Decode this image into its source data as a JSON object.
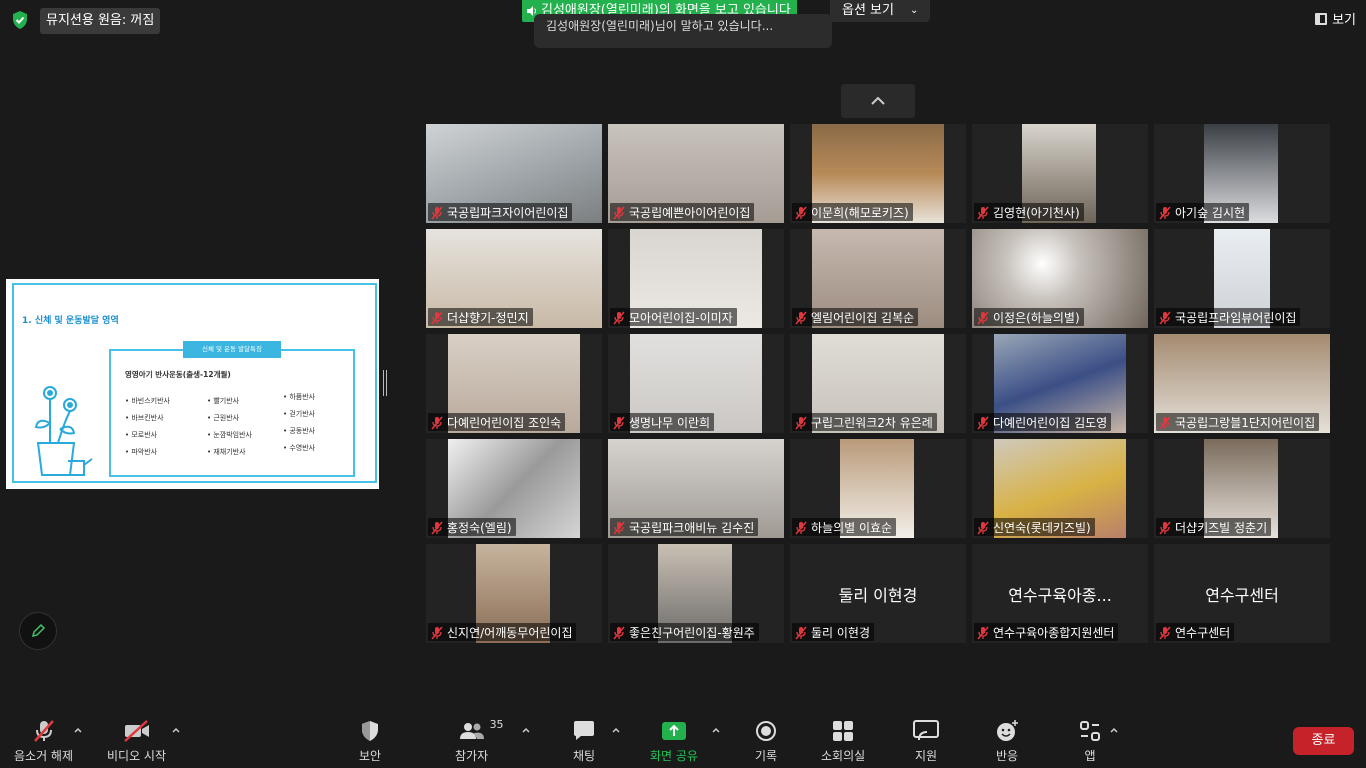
{
  "topbar": {
    "audio_label": "뮤지션용 원음: 꺼짐",
    "share_banner": "김성애원장(열린미래)의 화면을 보고 있습니다",
    "banner_subtitle": "김성애원장(열린미래)님이 말하고 있습니다...",
    "options_label": "옵션 보기",
    "view_label": "보기"
  },
  "slide": {
    "title": "1. 신체 및 운동발달 영역",
    "tag": "신체 및 운동 발달특징",
    "subtitle": "영영아기 반사운동(출생-12개월)",
    "col1": [
      "바빈스키반사",
      "바브킨반사",
      "모로반사",
      "파악반사"
    ],
    "col2": [
      "빨기반사",
      "근원반사",
      "눈깜박임반사",
      "재채기반사"
    ],
    "col3": [
      "하품반사",
      "걷기반사",
      "공동반사",
      "수영반사"
    ]
  },
  "participants": [
    {
      "name": "국공립파크자이어린이집",
      "kind": "video"
    },
    {
      "name": "국공립예쁜아이어린이집",
      "kind": "video"
    },
    {
      "name": "이문희(해모로키즈)",
      "kind": "video"
    },
    {
      "name": "김영현(아기천사)",
      "kind": "video"
    },
    {
      "name": "아기숲 김시현",
      "kind": "video"
    },
    {
      "name": "더샵향기-정민지",
      "kind": "video"
    },
    {
      "name": "모아어린이집-이미자",
      "kind": "video"
    },
    {
      "name": "엘림어린이집 김복순",
      "kind": "video"
    },
    {
      "name": "이정은(하늘의별)",
      "kind": "video"
    },
    {
      "name": "국공립프라임뷰어린이집",
      "kind": "video"
    },
    {
      "name": "다예린어린이집 조인숙",
      "kind": "video"
    },
    {
      "name": "생명나무 이란희",
      "kind": "video"
    },
    {
      "name": "구립그린워크2차 유은례",
      "kind": "video"
    },
    {
      "name": "다예린어린이집 김도영",
      "kind": "video"
    },
    {
      "name": "국공립그랑블1단지어린이집",
      "kind": "video"
    },
    {
      "name": "홍정숙(엘림)",
      "kind": "video"
    },
    {
      "name": "국공립파크애비뉴 김수진",
      "kind": "video"
    },
    {
      "name": "하늘의별 이효순",
      "kind": "video"
    },
    {
      "name": "신연숙(롯데키즈빌)",
      "kind": "video"
    },
    {
      "name": "더샵키즈빌 정춘기",
      "kind": "video"
    },
    {
      "name": "신지연/어깨동무어린이집",
      "kind": "video"
    },
    {
      "name": "좋은친구어린이집-황원주",
      "kind": "video"
    },
    {
      "name": "둘리 이현경",
      "kind": "text",
      "display": "둘리 이현경"
    },
    {
      "name": "연수구육아종합지원센터",
      "kind": "text",
      "display": "연수구육아종..."
    },
    {
      "name": "연수구센터",
      "kind": "text",
      "display": "연수구센터"
    }
  ],
  "toolbar": {
    "mute": "음소거 해제",
    "video": "비디오 시작",
    "security": "보안",
    "participants": "참가자",
    "participant_count": "35",
    "chat": "채팅",
    "share": "화면 공유",
    "record": "기록",
    "breakout": "소회의실",
    "support": "지원",
    "reactions": "반응",
    "apps": "앱",
    "end": "종료"
  },
  "colors": {
    "share_green": "#22b14c",
    "end_red": "#c52229",
    "slide_accent": "#46c2e6",
    "mic_off_red": "#e0383e"
  }
}
